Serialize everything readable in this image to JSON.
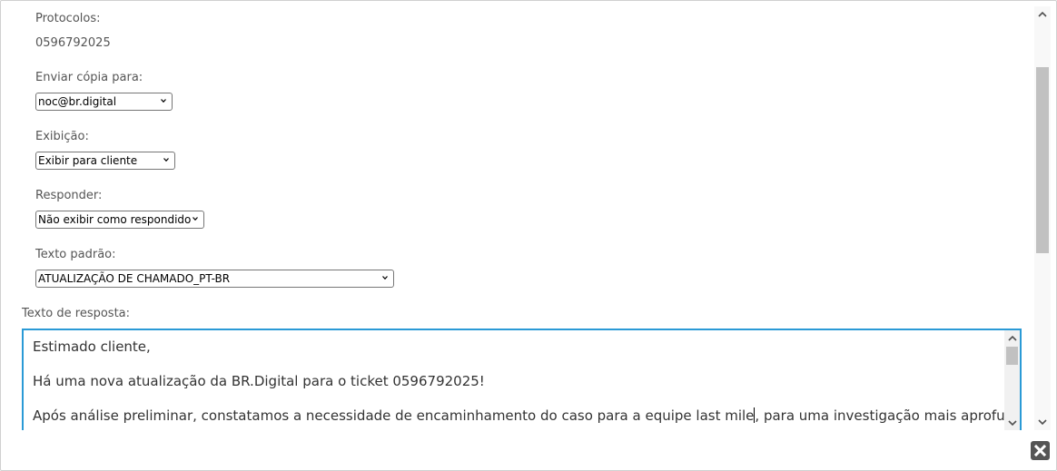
{
  "form": {
    "protocolos_label": "Protocolos:",
    "protocolos_value": "0596792025",
    "copia_label": "Enviar cópia para:",
    "copia_value": "noc@br.digital",
    "exibicao_label": "Exibição:",
    "exibicao_value": "Exibir para cliente",
    "responder_label": "Responder:",
    "responder_value": "Não exibir como respondido",
    "texto_padrao_label": "Texto padrão:",
    "texto_padrao_value": "ATUALIZAÇÃO DE CHAMADO_PT-BR",
    "texto_resposta_label": "Texto de resposta:"
  },
  "reply": {
    "line1": "Estimado cliente,",
    "line2": "Há uma nova atualização da BR.Digital para o ticket 0596792025!",
    "line3a": "Após análise preliminar, constatamos a necessidade de encaminhamento do caso para a equipe last mile",
    "line3b": ", para uma investigação mais aprofundada."
  },
  "icons": {
    "dropdown": "chevron-down-icon",
    "close": "close-icon",
    "scroll_up": "scroll-up-arrow-icon",
    "scroll_down": "scroll-down-arrow-icon"
  },
  "colors": {
    "textarea_border": "#2a9ad6",
    "close_button": "#555555"
  }
}
